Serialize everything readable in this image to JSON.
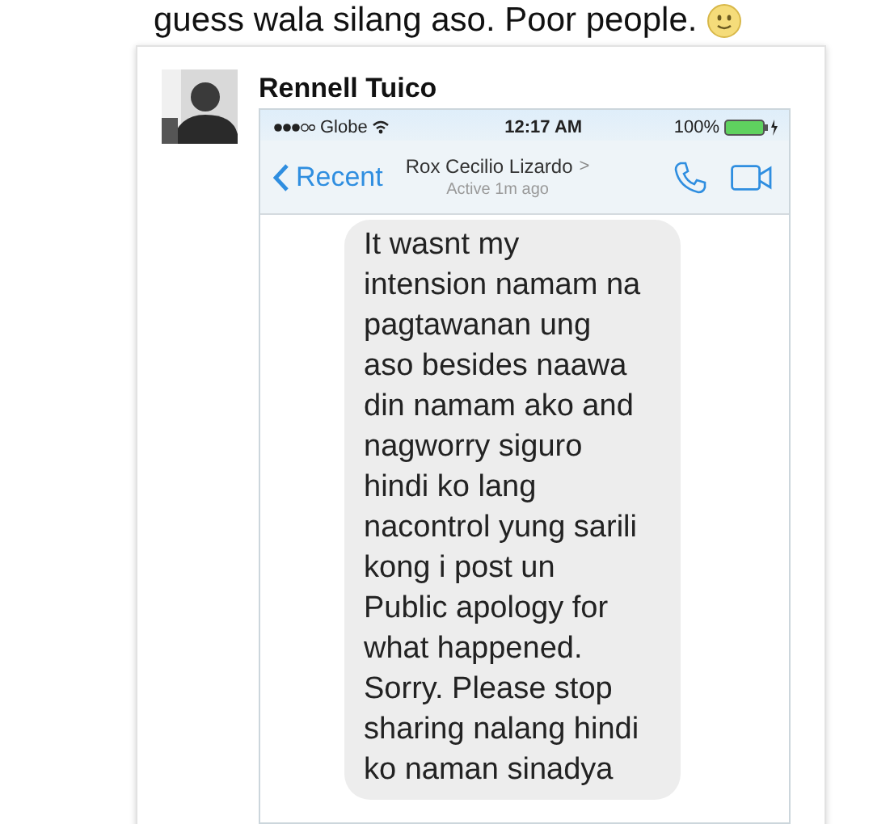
{
  "post": {
    "caption": "guess wala silang aso. Poor people.",
    "shared_post": {
      "author": "Rennell Tuico",
      "screenshot": {
        "status_bar": {
          "carrier": "Globe",
          "time": "12:17 AM",
          "battery": "100%"
        },
        "nav": {
          "back": "Recent",
          "contact": "Rox Cecilio Lizardo",
          "contact_arrow": ">",
          "presence": "Active 1m ago"
        },
        "message": {
          "lines": [
            "It wasnt my",
            "intension namam na",
            "pagtawanan ung",
            "aso besides naawa",
            "din namam ako and",
            "nagworry siguro",
            "hindi ko lang",
            "nacontrol yung sarili",
            "kong i post un",
            "Public apology for",
            "what happened.",
            "Sorry. Please stop",
            "sharing nalang hindi",
            "ko naman sinadya"
          ]
        }
      }
    }
  }
}
